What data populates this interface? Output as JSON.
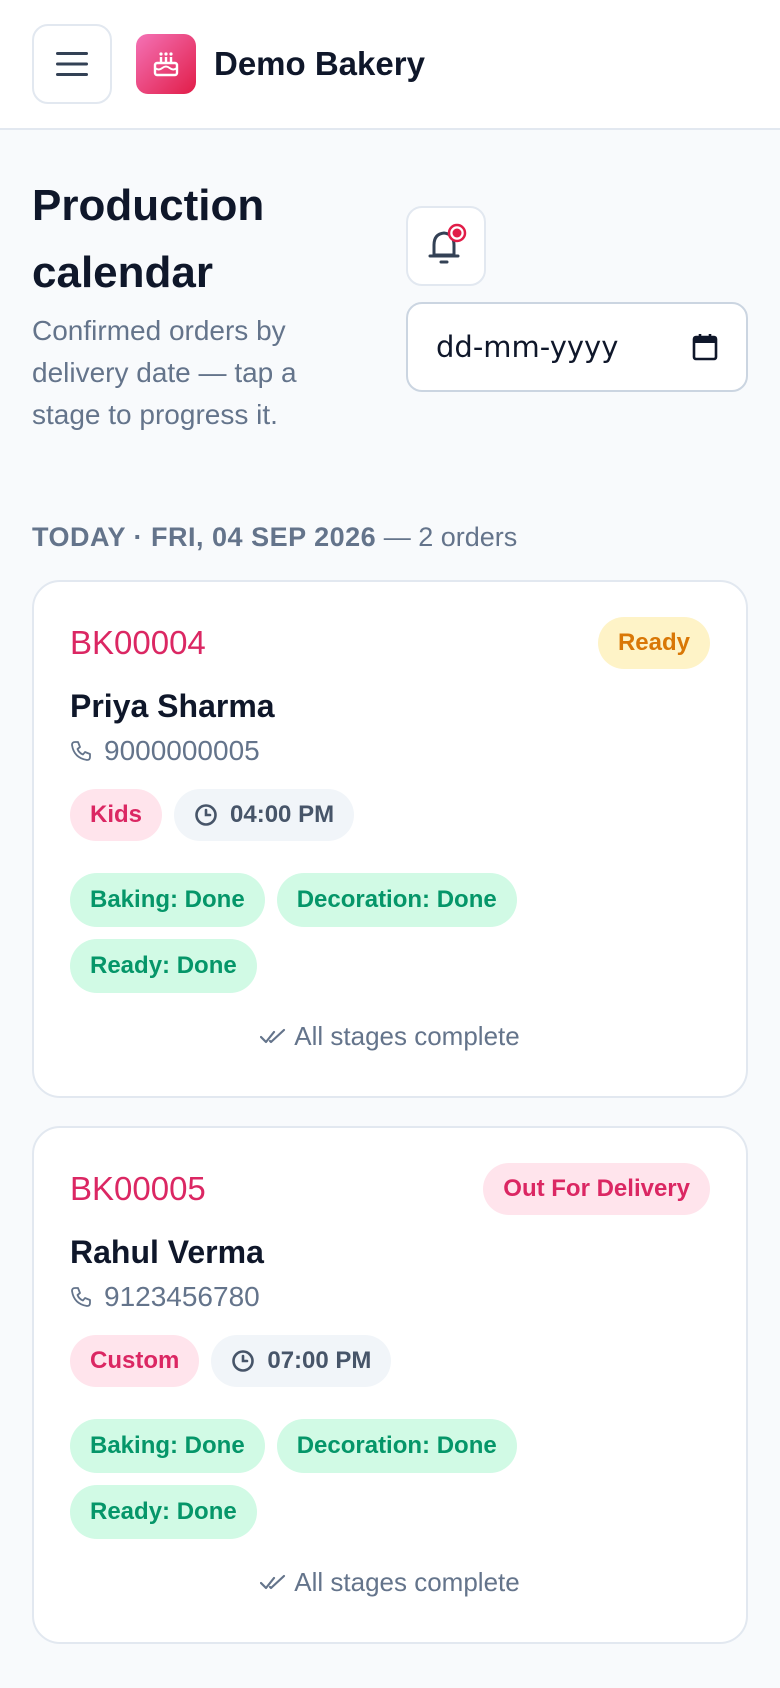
{
  "header": {
    "app_title": "Demo Bakery",
    "menu_icon": "hamburger-icon",
    "logo_icon": "cake-icon",
    "brand_color": "#e11d48"
  },
  "page": {
    "title": "Production calendar",
    "subtitle": "Confirmed orders by delivery date — tap a stage to progress it.",
    "notification_icon": "bell-icon",
    "date_placeholder": "dd-mm-yyyy"
  },
  "section": {
    "day_label": "TODAY · FRI, 04 SEP 2026",
    "count_label": "— 2 orders"
  },
  "orders": [
    {
      "id": "BK00004",
      "status": "Ready",
      "customer": "Priya Sharma",
      "phone": "9000000005",
      "category": "Kids",
      "time": "04:00 PM",
      "stages": [
        "Baking: Done",
        "Decoration: Done",
        "Ready: Done"
      ],
      "complete_label": "All stages complete"
    },
    {
      "id": "BK00005",
      "status": "Out For Delivery",
      "customer": "Rahul Verma",
      "phone": "9123456780",
      "category": "Custom",
      "time": "07:00 PM",
      "stages": [
        "Baking: Done",
        "Decoration: Done",
        "Ready: Done"
      ],
      "complete_label": "All stages complete"
    }
  ]
}
